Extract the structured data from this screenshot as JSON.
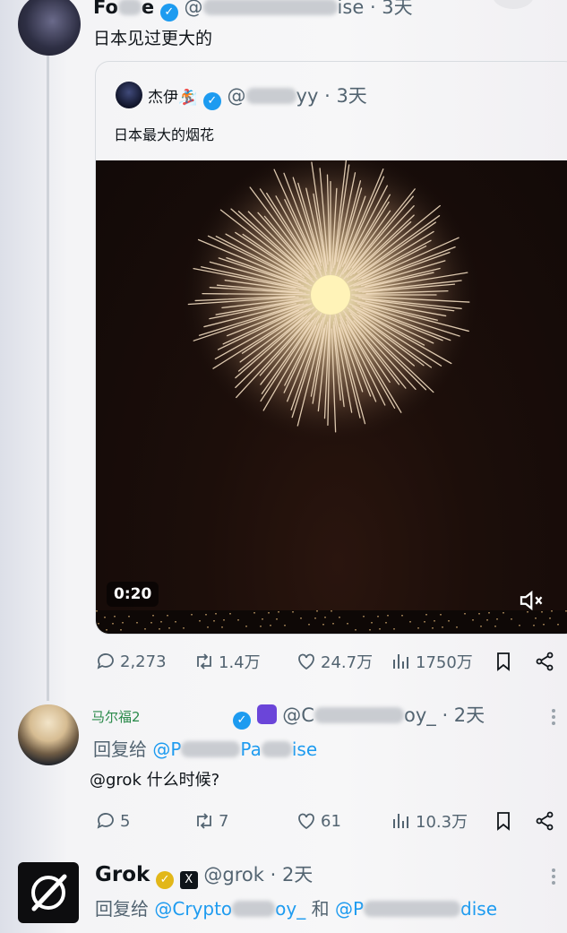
{
  "top_tweet": {
    "name": "Fo",
    "name_tail": "e",
    "handle_prefix": "@",
    "handle_tail": "ise",
    "time": "· 3天",
    "text": "日本见过更大的"
  },
  "quoted_tweet": {
    "name": "杰伊🏂",
    "handle_prefix": "@",
    "handle_tail": "yy",
    "time": "· 3天",
    "text": "日本最大的烟花",
    "video_duration": "0:20"
  },
  "top_actions": {
    "replies": "2,273",
    "retweets": "1.4万",
    "likes": "24.7万",
    "views": "1750万"
  },
  "reply_tweet": {
    "name": "马尔福2",
    "handle_prefix": "@C",
    "handle_tail": "oy_",
    "time": "· 2天",
    "reply_label": "回复给",
    "reply_mention_prefix": "@P",
    "reply_mention_mid": "Pa",
    "reply_mention_tail": "ise",
    "text": "@grok 什么时候?"
  },
  "reply_actions": {
    "replies": "5",
    "retweets": "7",
    "likes": "61",
    "views": "10.3万"
  },
  "grok_tweet": {
    "name": "Grok",
    "x_badge": "X",
    "handle": "@grok",
    "time": "· 2天",
    "reply_label": "回复给",
    "reply_mention_1": "@Crypto",
    "reply_mention_1_tail": "oy_",
    "reply_and": "和",
    "reply_mention_2": "@P",
    "reply_mention_2_tail": "dise"
  },
  "colors": {
    "verified_blue": "#1d9bf0",
    "verified_gold": "#e2b719",
    "muted_text": "#536471",
    "username_green": "#2a8a4a"
  }
}
